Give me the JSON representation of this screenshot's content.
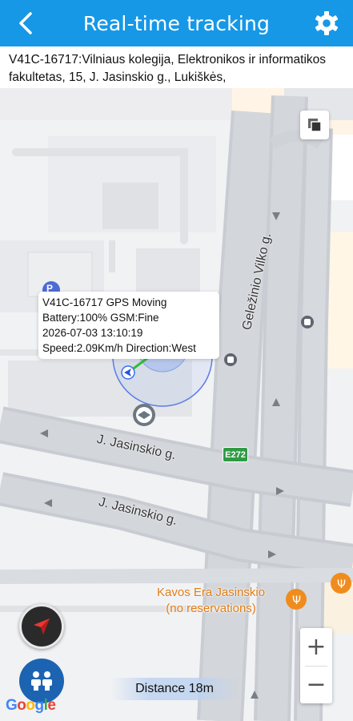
{
  "header": {
    "title": "Real-time tracking",
    "back_icon": "back-chevron-icon",
    "settings_icon": "gear-icon",
    "background": "#1698e6"
  },
  "address": {
    "text": "V41C-16717:Vilniaus kolegija, Elektronikos ir informatikos fakultetas, 15, J. Jasinskio g., Lukiškės,"
  },
  "map": {
    "streets": {
      "vilko": "Geležinio Vilko g.",
      "jasinskio_upper": "J. Jasinskio g.",
      "jasinskio_lower": "J. Jasinskio g."
    },
    "route_badge": "E272",
    "poi": {
      "line1": "Kavos Era Jasinskio",
      "line2": "(no reservations)",
      "color": "#e07b12"
    },
    "parking_badge": "P",
    "google_logo": "Google"
  },
  "popup": {
    "line1": "V41C-16717 GPS Moving",
    "line2": "Battery:100% GSM:Fine",
    "line3": "2026-07-03 13:10:19",
    "line4": "Speed:2.09Km/h Direction:West"
  },
  "controls": {
    "zoom_in": "+",
    "zoom_out": "−",
    "distance": "Distance 18m"
  }
}
